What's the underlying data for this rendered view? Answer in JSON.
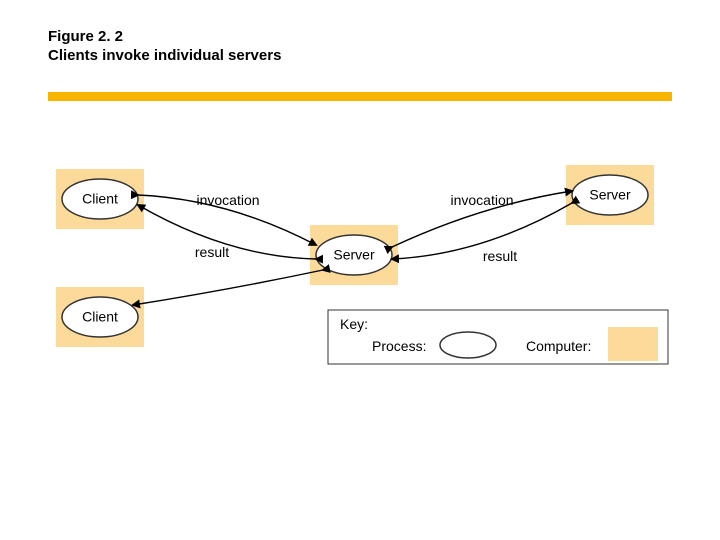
{
  "figure": {
    "number": "Figure 2. 2",
    "title": "Clients invoke individual servers"
  },
  "nodes": {
    "client1": "Client",
    "client2": "Client",
    "server_mid": "Server",
    "server_right": "Server"
  },
  "edges": {
    "invocation1": "invocation",
    "result1": "result",
    "invocation2": "invocation",
    "result2": "result"
  },
  "key": {
    "heading": "Key:",
    "process": "Process:",
    "computer": "Computer:"
  }
}
